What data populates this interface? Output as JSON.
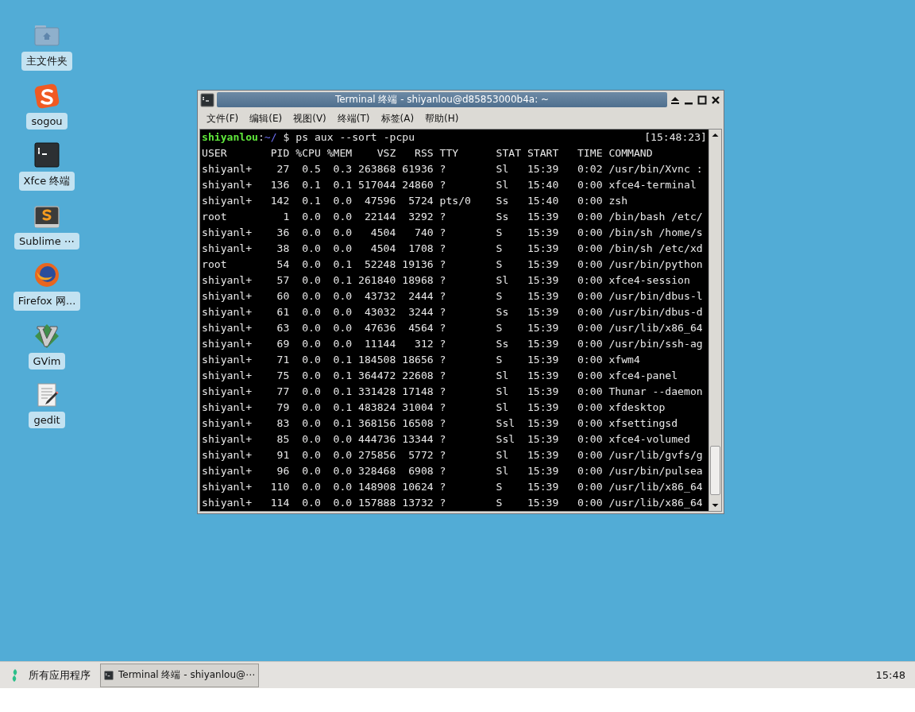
{
  "desktop_icons": [
    {
      "kind": "folder",
      "label": "主文件夹"
    },
    {
      "kind": "sogou",
      "label": "sogou"
    },
    {
      "kind": "terminal",
      "label": "Xfce 终端"
    },
    {
      "kind": "sublime",
      "label": "Sublime ⋯"
    },
    {
      "kind": "firefox",
      "label": "Firefox 网..."
    },
    {
      "kind": "vim",
      "label": "GVim"
    },
    {
      "kind": "gedit",
      "label": "gedit"
    }
  ],
  "window": {
    "title": "Terminal 终端 - shiyanlou@d85853000b4a: ~",
    "menu": [
      "文件(F)",
      "编辑(E)",
      "视图(V)",
      "终端(T)",
      "标签(A)",
      "帮助(H)"
    ]
  },
  "terminal": {
    "prompt": {
      "user": "shiyanlou",
      "separator": ":",
      "path": "~/",
      "command": " $ ps aux --sort -pcpu",
      "time": "[15:48:23]"
    },
    "lines": [
      "USER       PID %CPU %MEM    VSZ   RSS TTY      STAT START   TIME COMMAND",
      "shiyanl+    27  0.5  0.3 263868 61936 ?        Sl   15:39   0:02 /usr/bin/Xvnc :",
      "shiyanl+   136  0.1  0.1 517044 24860 ?        Sl   15:40   0:00 xfce4-terminal",
      "shiyanl+   142  0.1  0.0  47596  5724 pts/0    Ss   15:40   0:00 zsh",
      "root         1  0.0  0.0  22144  3292 ?        Ss   15:39   0:00 /bin/bash /etc/",
      "shiyanl+    36  0.0  0.0   4504   740 ?        S    15:39   0:00 /bin/sh /home/s",
      "shiyanl+    38  0.0  0.0   4504  1708 ?        S    15:39   0:00 /bin/sh /etc/xd",
      "root        54  0.0  0.1  52248 19136 ?        S    15:39   0:00 /usr/bin/python",
      "shiyanl+    57  0.0  0.1 261840 18968 ?        Sl   15:39   0:00 xfce4-session",
      "shiyanl+    60  0.0  0.0  43732  2444 ?        S    15:39   0:00 /usr/bin/dbus-l",
      "shiyanl+    61  0.0  0.0  43032  3244 ?        Ss   15:39   0:00 /usr/bin/dbus-d",
      "shiyanl+    63  0.0  0.0  47636  4564 ?        S    15:39   0:00 /usr/lib/x86_64",
      "shiyanl+    69  0.0  0.0  11144   312 ?        Ss   15:39   0:00 /usr/bin/ssh-ag",
      "shiyanl+    71  0.0  0.1 184508 18656 ?        S    15:39   0:00 xfwm4",
      "shiyanl+    75  0.0  0.1 364472 22608 ?        Sl   15:39   0:00 xfce4-panel",
      "shiyanl+    77  0.0  0.1 331428 17148 ?        Sl   15:39   0:00 Thunar --daemon",
      "shiyanl+    79  0.0  0.1 483824 31004 ?        Sl   15:39   0:00 xfdesktop",
      "shiyanl+    83  0.0  0.1 368156 16508 ?        Ssl  15:39   0:00 xfsettingsd",
      "shiyanl+    85  0.0  0.0 444736 13344 ?        Ssl  15:39   0:00 xfce4-volumed",
      "shiyanl+    91  0.0  0.0 275856  5772 ?        Sl   15:39   0:00 /usr/lib/gvfs/g",
      "shiyanl+    96  0.0  0.0 328468  6908 ?        Sl   15:39   0:00 /usr/bin/pulsea",
      "shiyanl+   110  0.0  0.0 148908 10624 ?        S    15:39   0:00 /usr/lib/x86_64",
      "shiyanl+   114  0.0  0.0 157888 13732 ?        S    15:39   0:00 /usr/lib/x86_64"
    ]
  },
  "taskbar": {
    "menu_label": "所有应用程序",
    "tasks": [
      {
        "label": "Terminal 终端 - shiyanlou@⋯",
        "selected": true
      }
    ],
    "clock": "15:48"
  }
}
